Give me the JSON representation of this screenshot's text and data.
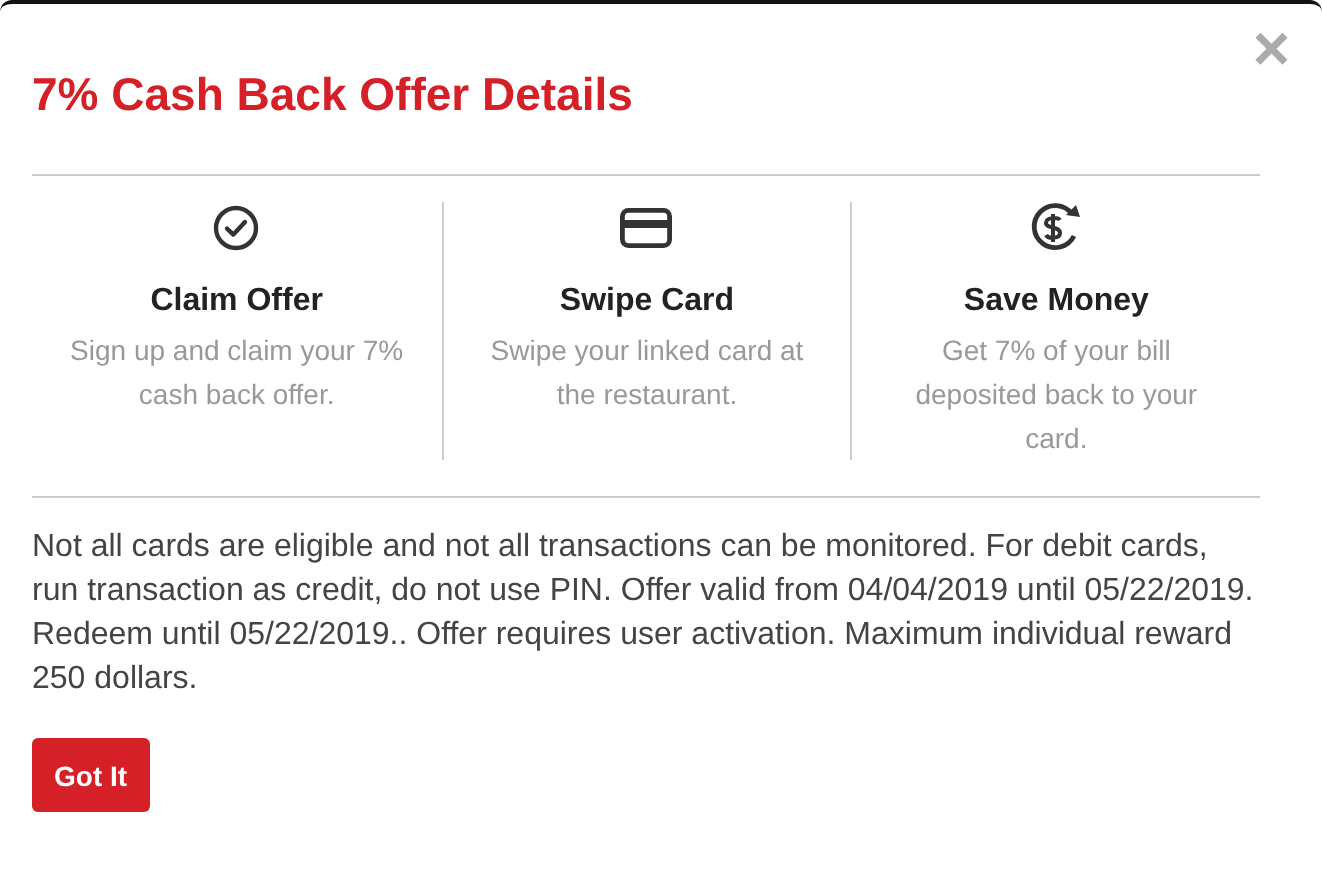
{
  "close_label": "×",
  "title": "7% Cash Back Offer Details",
  "steps": [
    {
      "kind": "check",
      "title": "Claim Offer",
      "description": "Sign up and claim your 7% cash back offer."
    },
    {
      "kind": "card",
      "title": "Swipe Card",
      "description": "Swipe your linked card at the restaurant."
    },
    {
      "kind": "money",
      "title": "Save Money",
      "description": "Get 7% of your bill deposited back to your card."
    }
  ],
  "terms": "Not all cards are eligible and not all transactions can be monitored. For debit cards, run transaction as credit, do not use PIN. Offer valid from 04/04/2019 until 05/22/2019. Redeem until 05/22/2019.. Offer requires user activation. Maximum individual reward 250 dollars.",
  "button": "Got It"
}
